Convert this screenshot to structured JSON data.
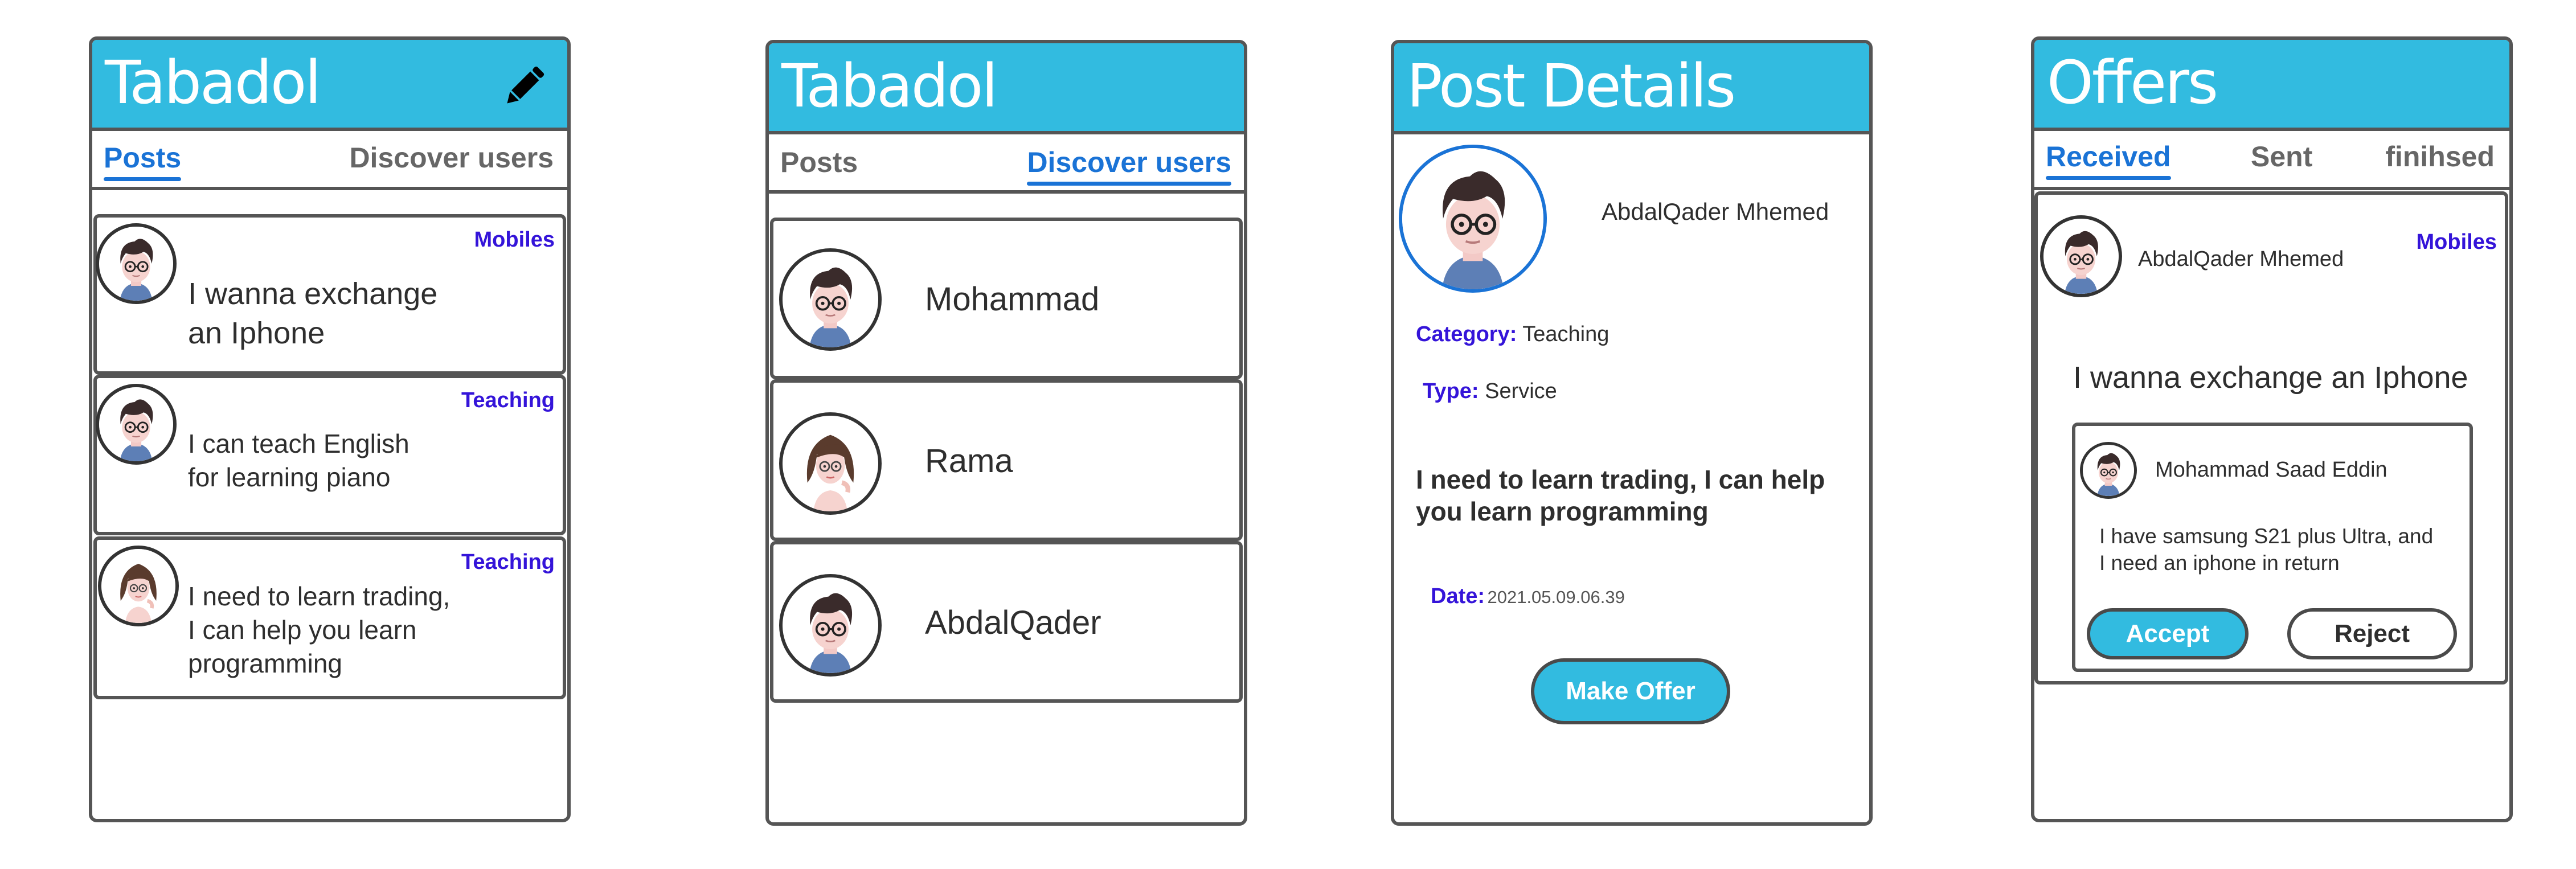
{
  "feed": {
    "title": "Tabadol",
    "tabs": [
      "Posts",
      "Discover users"
    ],
    "posts": [
      {
        "category": "Mobiles",
        "line1": "I wanna exchange",
        "line2": "an Iphone",
        "line3": ""
      },
      {
        "category": "Teaching",
        "line1": "I can teach English",
        "line2": "for learning piano",
        "line3": ""
      },
      {
        "category": "Teaching",
        "line1": "I need to learn trading,",
        "line2": "I can help you learn",
        "line3": "programming"
      }
    ]
  },
  "discover": {
    "title": "Tabadol",
    "tabs": [
      "Posts",
      "Discover users"
    ],
    "users": [
      "Mohammad",
      "Rama",
      "AbdalQader"
    ]
  },
  "details": {
    "title": "Post Details",
    "author": "AbdalQader Mhemed",
    "category_label": "Category:",
    "category_value": "Teaching",
    "type_label": "Type:",
    "type_value": "Service",
    "body_line1": "I need to learn trading, I can help",
    "body_line2": "you learn programming",
    "date_label": "Date:",
    "date_value": "2021.05.09.06.39",
    "button": "Make Offer"
  },
  "offers": {
    "title": "Offers",
    "tabs": [
      "Received",
      "Sent",
      "finihsed"
    ],
    "post": {
      "author": "AbdalQader Mhemed",
      "category": "Mobiles",
      "text": "I wanna exchange an Iphone"
    },
    "offer": {
      "author": "Mohammad Saad Eddin",
      "line1": "I have samsung S21 plus Ultra, and",
      "line2": "I need an iphone in return",
      "accept": "Accept",
      "reject": "Reject"
    }
  },
  "icons": {
    "edit": "pencil-icon",
    "male_avatar": "male-avatar-icon",
    "female_avatar": "female-avatar-icon"
  },
  "colors": {
    "header": "#32bbe0",
    "active_tab": "#1a73d6",
    "category": "#3414d9",
    "border": "#555555"
  }
}
